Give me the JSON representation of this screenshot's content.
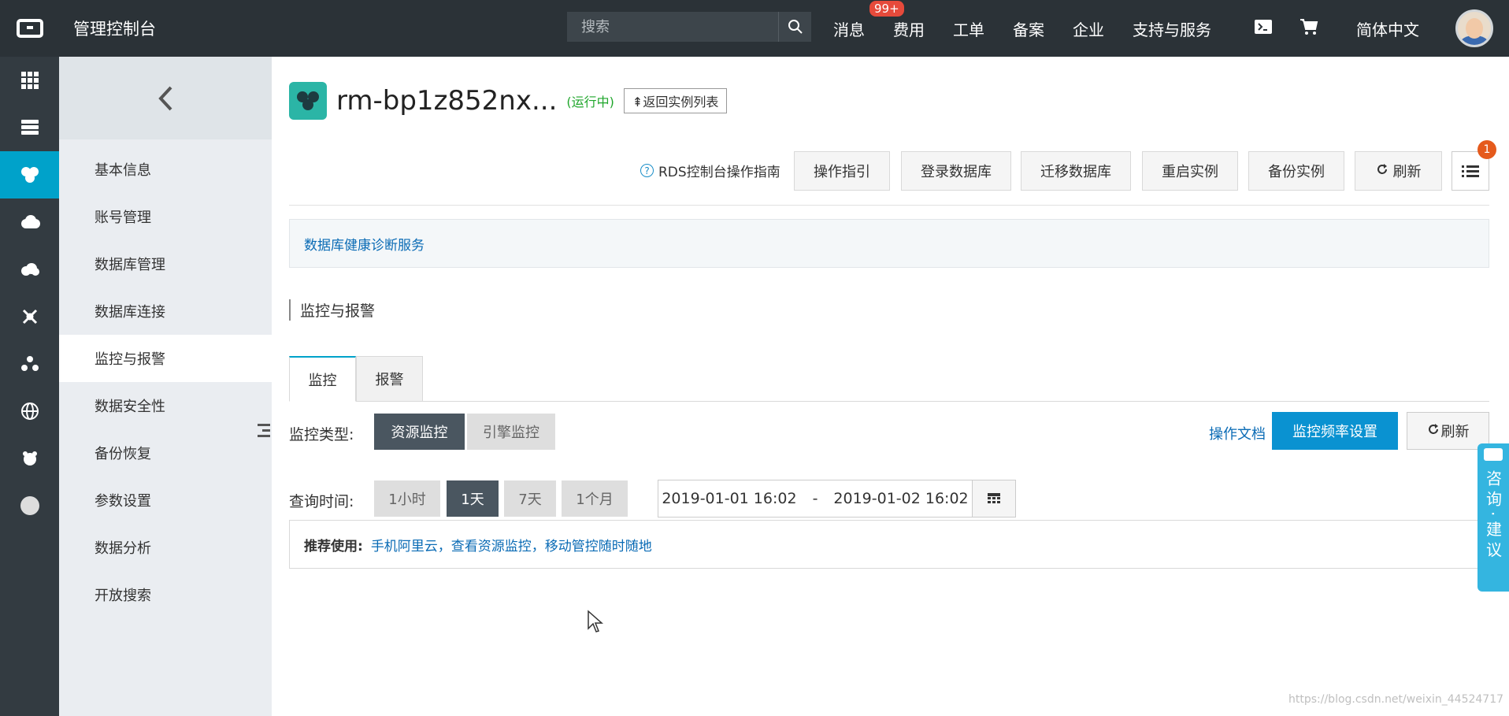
{
  "topbar": {
    "title": "管理控制台",
    "search_placeholder": "搜索",
    "nav": [
      {
        "label": "消息",
        "badge": "99+"
      },
      {
        "label": "费用"
      },
      {
        "label": "工单"
      },
      {
        "label": "备案"
      },
      {
        "label": "企业"
      },
      {
        "label": "支持与服务"
      }
    ],
    "language": "简体中文"
  },
  "rail": {
    "icons": [
      "apps-grid-icon",
      "server-icon",
      "rds-icon",
      "cloud-icon",
      "cloud-storage-icon",
      "network-icon",
      "cluster-icon",
      "globe-icon",
      "settings-icon",
      "dot-icon"
    ],
    "active_index": 2
  },
  "sidebar": {
    "back_label": "‹",
    "items": [
      {
        "label": "基本信息"
      },
      {
        "label": "账号管理"
      },
      {
        "label": "数据库管理"
      },
      {
        "label": "数据库连接"
      },
      {
        "label": "监控与报警"
      },
      {
        "label": "数据安全性"
      },
      {
        "label": "备份恢复"
      },
      {
        "label": "参数设置"
      },
      {
        "label": "数据分析"
      },
      {
        "label": "开放搜索"
      }
    ],
    "active_index": 4
  },
  "instance": {
    "name": "rm-bp1z852nx...",
    "status": "(运行中)",
    "back_to_list": "⇞返回实例列表"
  },
  "actions": {
    "guide": "RDS控制台操作指南",
    "buttons": [
      "操作指引",
      "登录数据库",
      "迁移数据库",
      "重启实例",
      "备份实例",
      "刷新"
    ],
    "menu_badge": "1"
  },
  "health": {
    "link": "数据库健康诊断服务"
  },
  "section": {
    "title": "监控与报警"
  },
  "tabs": [
    "监控",
    "报警"
  ],
  "monitor": {
    "type_label": "监控类型:",
    "types": [
      "资源监控",
      "引擎监控"
    ],
    "active_type": 0,
    "doc_link": "操作文档",
    "freq_button": "监控频率设置",
    "refresh_button": "刷新"
  },
  "query": {
    "time_label": "查询时间:",
    "ranges": [
      "1小时",
      "1天",
      "7天",
      "1个月"
    ],
    "active_range": 1,
    "start": "2019-01-01 16:02",
    "separator": "-",
    "end": "2019-01-02 16:02"
  },
  "recommend": {
    "label": "推荐使用:",
    "link": "手机阿里云，查看资源监控，移动管控随时随地"
  },
  "consult": {
    "text": "咨询·建议"
  },
  "watermark": "https://blog.csdn.net/weixin_44524717",
  "colors": {
    "topbar": "#2b3237",
    "accent": "#00a2ca",
    "primary_button": "#0a92d1",
    "running_status": "#1fa62b",
    "badge": "#e64a3b"
  }
}
